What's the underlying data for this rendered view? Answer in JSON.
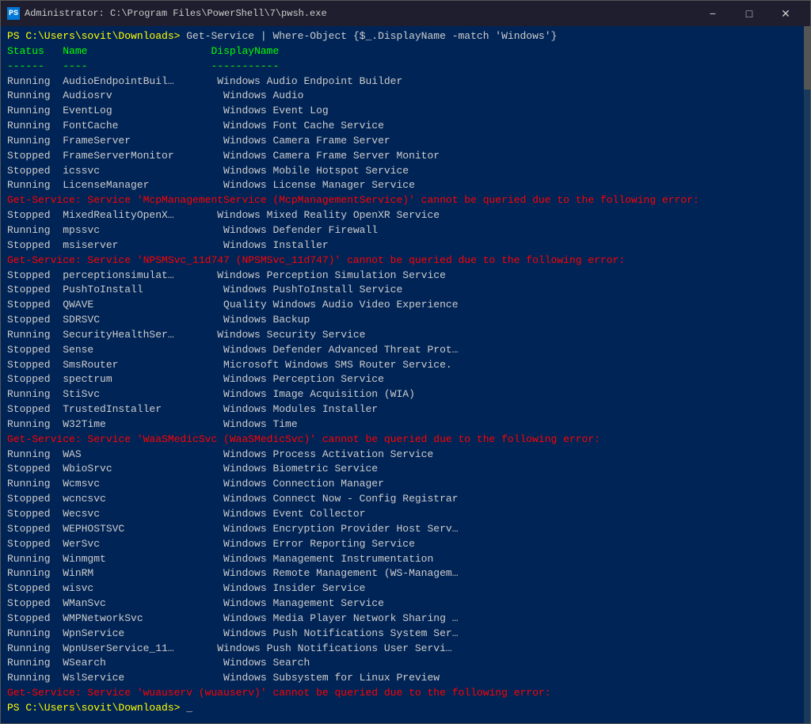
{
  "titleBar": {
    "icon": "PS",
    "text": "Administrator: C:\\Program Files\\PowerShell\\7\\pwsh.exe",
    "minimize": "−",
    "maximize": "□",
    "close": "✕"
  },
  "terminal": {
    "promptLine": "PS C:\\Users\\sovit\\Downloads> Get-Service | Where-Object {$_.DisplayName -match 'Windows'}",
    "headers": {
      "status": "Status",
      "name": "Name",
      "displayName": "DisplayName"
    },
    "lines": [
      {
        "type": "white",
        "status": "Running",
        "name": "AudioEndpointBuil…",
        "display": "Windows Audio Endpoint Builder"
      },
      {
        "type": "white",
        "status": "Running",
        "name": "Audiosrv",
        "display": "Windows Audio"
      },
      {
        "type": "white",
        "status": "Running",
        "name": "EventLog",
        "display": "Windows Event Log"
      },
      {
        "type": "white",
        "status": "Running",
        "name": "FontCache",
        "display": "Windows Font Cache Service"
      },
      {
        "type": "white",
        "status": "Running",
        "name": "FrameServer",
        "display": "Windows Camera Frame Server"
      },
      {
        "type": "white",
        "status": "Stopped",
        "name": "FrameServerMonitor",
        "display": "Windows Camera Frame Server Monitor"
      },
      {
        "type": "white",
        "status": "Stopped",
        "name": "icssvc",
        "display": "Windows Mobile Hotspot Service"
      },
      {
        "type": "white",
        "status": "Running",
        "name": "LicenseManager",
        "display": "Windows License Manager Service"
      },
      {
        "type": "red",
        "text": "Get-Service: Service 'McpManagementService (McpManagementService)' cannot be queried due to the following error:"
      },
      {
        "type": "white",
        "status": "Stopped",
        "name": "MixedRealityOpenX…",
        "display": "Windows Mixed Reality OpenXR Service"
      },
      {
        "type": "white",
        "status": "Running",
        "name": "mpssvc",
        "display": "Windows Defender Firewall"
      },
      {
        "type": "white",
        "status": "Stopped",
        "name": "msiserver",
        "display": "Windows Installer"
      },
      {
        "type": "red",
        "text": "Get-Service: Service 'NPSMSvc_11d747 (NPSMSvc_11d747)' cannot be queried due to the following error:"
      },
      {
        "type": "white",
        "status": "Stopped",
        "name": "perceptionsimulat…",
        "display": "Windows Perception Simulation Service"
      },
      {
        "type": "white",
        "status": "Stopped",
        "name": "PushToInstall",
        "display": "Windows PushToInstall Service"
      },
      {
        "type": "white",
        "status": "Stopped",
        "name": "QWAVE",
        "display": "Quality Windows Audio Video Experience"
      },
      {
        "type": "white",
        "status": "Stopped",
        "name": "SDRSVC",
        "display": "Windows Backup"
      },
      {
        "type": "white",
        "status": "Running",
        "name": "SecurityHealthSer…",
        "display": "Windows Security Service"
      },
      {
        "type": "white",
        "status": "Stopped",
        "name": "Sense",
        "display": "Windows Defender Advanced Threat Prot…"
      },
      {
        "type": "white",
        "status": "Stopped",
        "name": "SmsRouter",
        "display": "Microsoft Windows SMS Router Service."
      },
      {
        "type": "white",
        "status": "Stopped",
        "name": "spectrum",
        "display": "Windows Perception Service"
      },
      {
        "type": "white",
        "status": "Running",
        "name": "StiSvc",
        "display": "Windows Image Acquisition (WIA)"
      },
      {
        "type": "white",
        "status": "Stopped",
        "name": "TrustedInstaller",
        "display": "Windows Modules Installer"
      },
      {
        "type": "white",
        "status": "Running",
        "name": "W32Time",
        "display": "Windows Time"
      },
      {
        "type": "red",
        "text": "Get-Service: Service 'WaaSMedicSvc (WaaSMedicSvc)' cannot be queried due to the following error:"
      },
      {
        "type": "white",
        "status": "Running",
        "name": "WAS",
        "display": "Windows Process Activation Service"
      },
      {
        "type": "white",
        "status": "Stopped",
        "name": "WbioSrvc",
        "display": "Windows Biometric Service"
      },
      {
        "type": "white",
        "status": "Running",
        "name": "Wcmsvc",
        "display": "Windows Connection Manager"
      },
      {
        "type": "white",
        "status": "Stopped",
        "name": "wcncsvc",
        "display": "Windows Connect Now - Config Registrar"
      },
      {
        "type": "white",
        "status": "Stopped",
        "name": "Wecsvc",
        "display": "Windows Event Collector"
      },
      {
        "type": "white",
        "status": "Stopped",
        "name": "WEPHOSTSVC",
        "display": "Windows Encryption Provider Host Serv…"
      },
      {
        "type": "white",
        "status": "Stopped",
        "name": "WerSvc",
        "display": "Windows Error Reporting Service"
      },
      {
        "type": "white",
        "status": "Running",
        "name": "Winmgmt",
        "display": "Windows Management Instrumentation"
      },
      {
        "type": "white",
        "status": "Running",
        "name": "WinRM",
        "display": "Windows Remote Management (WS-Managem…"
      },
      {
        "type": "white",
        "status": "Stopped",
        "name": "wisvc",
        "display": "Windows Insider Service"
      },
      {
        "type": "white",
        "status": "Stopped",
        "name": "WManSvc",
        "display": "Windows Management Service"
      },
      {
        "type": "white",
        "status": "Stopped",
        "name": "WMPNetworkSvc",
        "display": "Windows Media Player Network Sharing …"
      },
      {
        "type": "white",
        "status": "Running",
        "name": "WpnService",
        "display": "Windows Push Notifications System Ser…"
      },
      {
        "type": "white",
        "status": "Running",
        "name": "WpnUserService_11…",
        "display": "Windows Push Notifications User Servi…"
      },
      {
        "type": "white",
        "status": "Running",
        "name": "WSearch",
        "display": "Windows Search"
      },
      {
        "type": "white",
        "status": "Running",
        "name": "WslService",
        "display": "Windows Subsystem for Linux Preview"
      },
      {
        "type": "red",
        "text": "Get-Service: Service 'wuauserv (wuauserv)' cannot be queried due to the following error:"
      }
    ],
    "finalPrompt": "PS C:\\Users\\sovit\\Downloads> _"
  }
}
